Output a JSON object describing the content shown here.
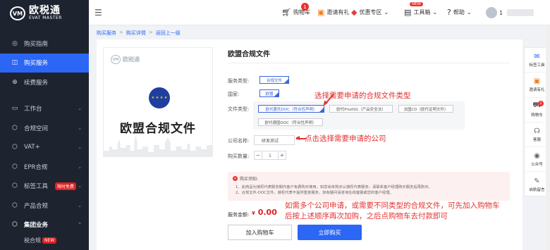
{
  "brand": {
    "name": "欧税通",
    "sub": "EVAT MASTER",
    "mark": "VM"
  },
  "sidebar": {
    "items": [
      {
        "label": "购买指南",
        "icon": "◎",
        "active": false
      },
      {
        "label": "购买服务",
        "icon": "◫",
        "active": true
      },
      {
        "label": "续费服务",
        "icon": "⊕",
        "active": false
      },
      {
        "label": "工作台",
        "icon": "▭",
        "active": false,
        "chev": "⌄"
      },
      {
        "label": "合规空间",
        "icon": "⬡",
        "active": false,
        "chev": "⌄"
      },
      {
        "label": "VAT+",
        "icon": "⬡",
        "active": false,
        "chev": "⌄"
      },
      {
        "label": "EPR合规",
        "icon": "⬡",
        "active": false,
        "chev": "⌄"
      },
      {
        "label": "标签工具",
        "icon": "⬡",
        "active": false,
        "chev": "⌄",
        "badge": "限时免费"
      },
      {
        "label": "产品合规",
        "icon": "⬡",
        "active": false,
        "chev": "⌄"
      },
      {
        "label": "集团业务",
        "icon": "⬡",
        "active": false,
        "chev": "⌃"
      }
    ],
    "sub_item": "税合规",
    "sub_badge": "NEW"
  },
  "topbar": {
    "cart": "购物车",
    "cart_count": "1",
    "invite": "邀请有礼",
    "deals": "优惠专区",
    "deals_chev": "⌄",
    "toolbox": "工具箱",
    "toolbox_tag": "NEW",
    "toolbox_chev": "⌄",
    "help": "帮助",
    "help_chev": "⌄",
    "user": "1"
  },
  "breadcrumb": [
    "购买服务",
    "购买详情",
    "返回上一级"
  ],
  "product": {
    "image_brand": "欧税通",
    "image_title": "欧盟合规文件",
    "stars": "★ ★ ★ ★",
    "title": "欧盟合规文件",
    "service_type_label": "服务类型:",
    "service_type": "合规文件",
    "country_label": "国家:",
    "country": "欧盟",
    "file_type_label": "文件类型:",
    "file_types": [
      "欧代委托DOC（符合性声明）",
      "欧代ProdSG（产品安全法）",
      "法国CD（欧代证明文件）",
      "欧代德国DOC（符合性声明）"
    ],
    "company_label": "公司名称:",
    "company": "研发测试",
    "qty_label": "购买数量:",
    "qty": "1",
    "qty_minus": "−",
    "qty_plus": "+",
    "notice_title": "购买须知:",
    "notice_icon": "×",
    "notice_lines": [
      "1、此商品为授权代表服务期内客户免费购买使用，如您尚未购买认授权代表服务，请联系客户经理购买服务后再购买。",
      "2、合规文件-DOC文件，授权代表不提供重复服务，如有疑问请咨询在线客服或您的客户经理。"
    ],
    "total_label": "服务金额:",
    "currency": "¥",
    "total": "0.00",
    "add_cart": "加入购物车",
    "buy_now": "立即购买"
  },
  "annotations": {
    "a1": "选择需要申请的合规文件类型",
    "a2": "点击选择需要申请的公司",
    "a3_line1": "如需多个公司申请，或需要不同类型的合规文件，可先加入购物车",
    "a3_line2": "后按上述顺序再次加购，之后点购物车去付款即可"
  },
  "right_panel": [
    {
      "label": "标签工具",
      "icon": "✉"
    },
    {
      "label": "邀请有礼",
      "icon": "▣"
    },
    {
      "label": "购物车",
      "icon": "⛟",
      "count": "1"
    },
    {
      "label": "客服",
      "icon": "☊"
    },
    {
      "label": "公众号",
      "icon": "◉"
    },
    {
      "label": "启航留言",
      "icon": "✎"
    }
  ],
  "colors": {
    "accent": "#2b66f5",
    "sidebar": "#1e2330",
    "annotation": "#e53030"
  }
}
